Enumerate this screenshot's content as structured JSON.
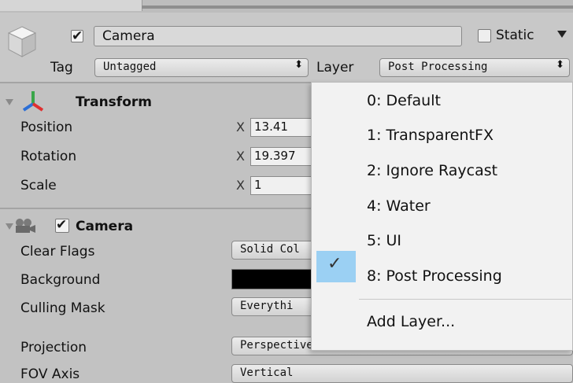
{
  "header": {
    "object_name": "Camera",
    "active_checked": true,
    "static_label": "Static",
    "tag_label": "Tag",
    "tag_value": "Untagged",
    "layer_label": "Layer",
    "layer_value": "Post Processing",
    "dropdown_arrow": "⬍"
  },
  "transform": {
    "title": "Transform",
    "rows": [
      {
        "label": "Position",
        "axis": "X",
        "x": "13.41"
      },
      {
        "label": "Rotation",
        "axis": "X",
        "x": "19.397"
      },
      {
        "label": "Scale",
        "axis": "X",
        "x": "1"
      }
    ]
  },
  "camera": {
    "title": "Camera",
    "enabled": true,
    "rows": [
      {
        "label": "Clear Flags",
        "value": "Solid Col"
      },
      {
        "label": "Background",
        "value": ""
      },
      {
        "label": "Culling Mask",
        "value": "Everythi"
      },
      {
        "label": "Projection",
        "value": "Perspective"
      },
      {
        "label": "FOV Axis",
        "value": "Vertical"
      }
    ],
    "background_color": "#000000"
  },
  "layer_menu": {
    "items": [
      {
        "label": "0: Default",
        "selected": false
      },
      {
        "label": "1: TransparentFX",
        "selected": false
      },
      {
        "label": "2: Ignore Raycast",
        "selected": false
      },
      {
        "label": "4: Water",
        "selected": false
      },
      {
        "label": "5: UI",
        "selected": false
      },
      {
        "label": "8: Post Processing",
        "selected": true
      }
    ],
    "add_layer": "Add Layer...",
    "selected_highlight": "#9bd0f3"
  }
}
